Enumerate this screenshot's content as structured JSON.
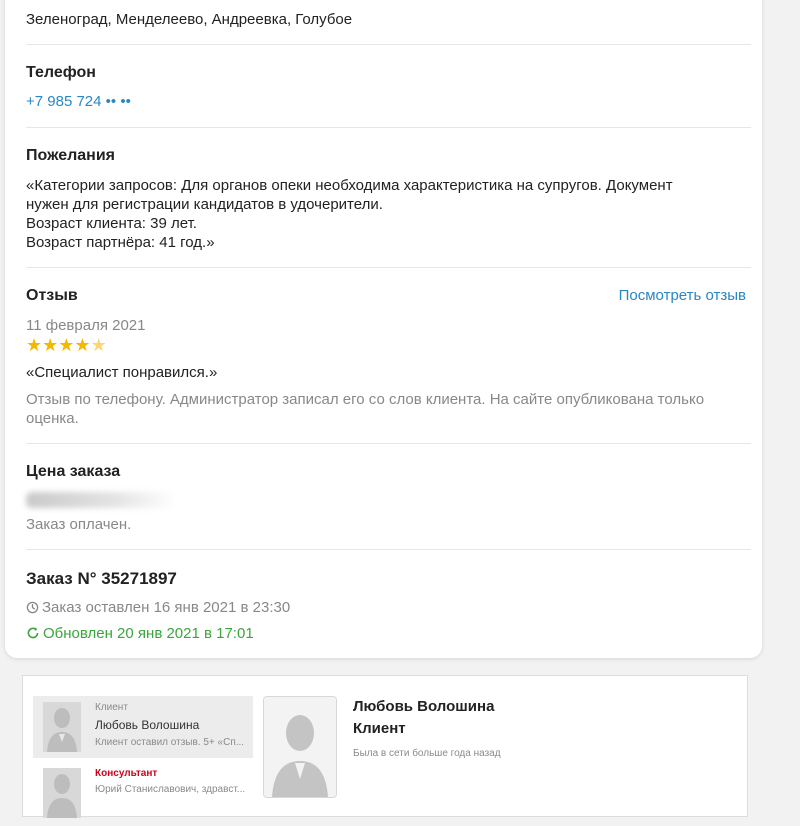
{
  "address": {
    "text": "Зеленоград, Менделеево, Андреевка, Голубое"
  },
  "phone": {
    "label": "Телефон",
    "value": "+7 985 724 •• ••"
  },
  "wishes": {
    "label": "Пожелания",
    "lines": [
      "«Категории запросов: Для органов опеки необходима характеристика на супругов. Документ",
      "нужен для регистрации кандидатов в удочерители.",
      "Возраст клиента: 39 лет.",
      "Возраст партнёра: 41 год.»"
    ]
  },
  "review": {
    "label": "Отзыв",
    "view_link": "Посмотреть отзыв",
    "date": "11 февраля 2021",
    "rating": 4.5,
    "rating_max": 5,
    "quote": "«Специалист понравился.»",
    "note_lines": [
      "Отзыв по телефону. Администратор записал его со слов клиента. На сайте опубликована только",
      "оценка."
    ]
  },
  "price": {
    "label": "Цена заказа",
    "status": "Заказ оплачен."
  },
  "order": {
    "title": "Заказ N° 35271897",
    "created": "Заказ оставлен 16 янв 2021 в 23:30",
    "updated": "Обновлен 20 янв 2021 в 17:01"
  },
  "chat": {
    "items": [
      {
        "role": "Клиент",
        "name": "Любовь Волошина",
        "preview": "Клиент оставил отзыв. 5+ «Сп..."
      },
      {
        "role": "Консультант",
        "preview": "Юрий Станиславович, здравст..."
      }
    ],
    "profile": {
      "name": "Любовь Волошина",
      "role": "Клиент",
      "last_seen": "Была в сети больше года назад"
    }
  },
  "colors": {
    "link": "#2b86c5",
    "star": "#f5b800",
    "updated": "#3aa53a",
    "consultant_role": "#d0021b"
  }
}
